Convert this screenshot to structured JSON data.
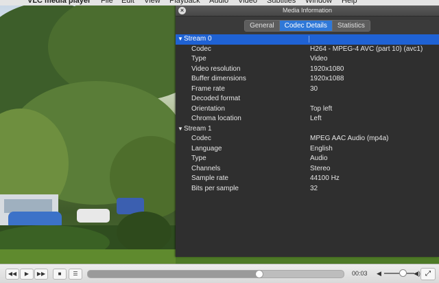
{
  "menubar": {
    "apple": "",
    "app_name": "VLC media player",
    "items": [
      "File",
      "Edit",
      "View",
      "Playback",
      "Audio",
      "Video",
      "Subtitles",
      "Window",
      "Help"
    ]
  },
  "panel": {
    "title": "Media Information",
    "close_icon": "×",
    "tabs": [
      {
        "label": "General",
        "active": false
      },
      {
        "label": "Codec Details",
        "active": true
      },
      {
        "label": "Statistics",
        "active": false
      }
    ],
    "streams": [
      {
        "label": "Stream 0",
        "expanded": true,
        "selected": true,
        "fields": [
          {
            "key": "Codec",
            "value": "H264 - MPEG-4 AVC (part 10) (avc1)"
          },
          {
            "key": "Type",
            "value": "Video"
          },
          {
            "key": "Video resolution",
            "value": "1920x1080"
          },
          {
            "key": "Buffer dimensions",
            "value": "1920x1088"
          },
          {
            "key": "Frame rate",
            "value": "30"
          },
          {
            "key": "Decoded format",
            "value": ""
          },
          {
            "key": "Orientation",
            "value": "Top left"
          },
          {
            "key": "Chroma location",
            "value": "Left"
          }
        ]
      },
      {
        "label": "Stream 1",
        "expanded": true,
        "selected": false,
        "fields": [
          {
            "key": "Codec",
            "value": "MPEG AAC Audio (mp4a)"
          },
          {
            "key": "Language",
            "value": "English"
          },
          {
            "key": "Type",
            "value": "Audio"
          },
          {
            "key": "Channels",
            "value": "Stereo"
          },
          {
            "key": "Sample rate",
            "value": "44100 Hz"
          },
          {
            "key": "Bits per sample",
            "value": "32"
          }
        ]
      }
    ]
  },
  "controls": {
    "rewind_icon": "◀◀",
    "play_icon": "▶",
    "forward_icon": "▶▶",
    "stop_icon": "■",
    "playlist_icon": "☰",
    "elapsed_time": "00:03",
    "seek_progress": 0.67,
    "volume_low_icon": "◀",
    "volume_high_icon": "◀)",
    "volume_level": 0.6,
    "fullscreen_icon": "⤢"
  },
  "colors": {
    "accent": "#2f78d8",
    "selection": "#1f62d4",
    "panel_bg": "#2f2f2f"
  }
}
